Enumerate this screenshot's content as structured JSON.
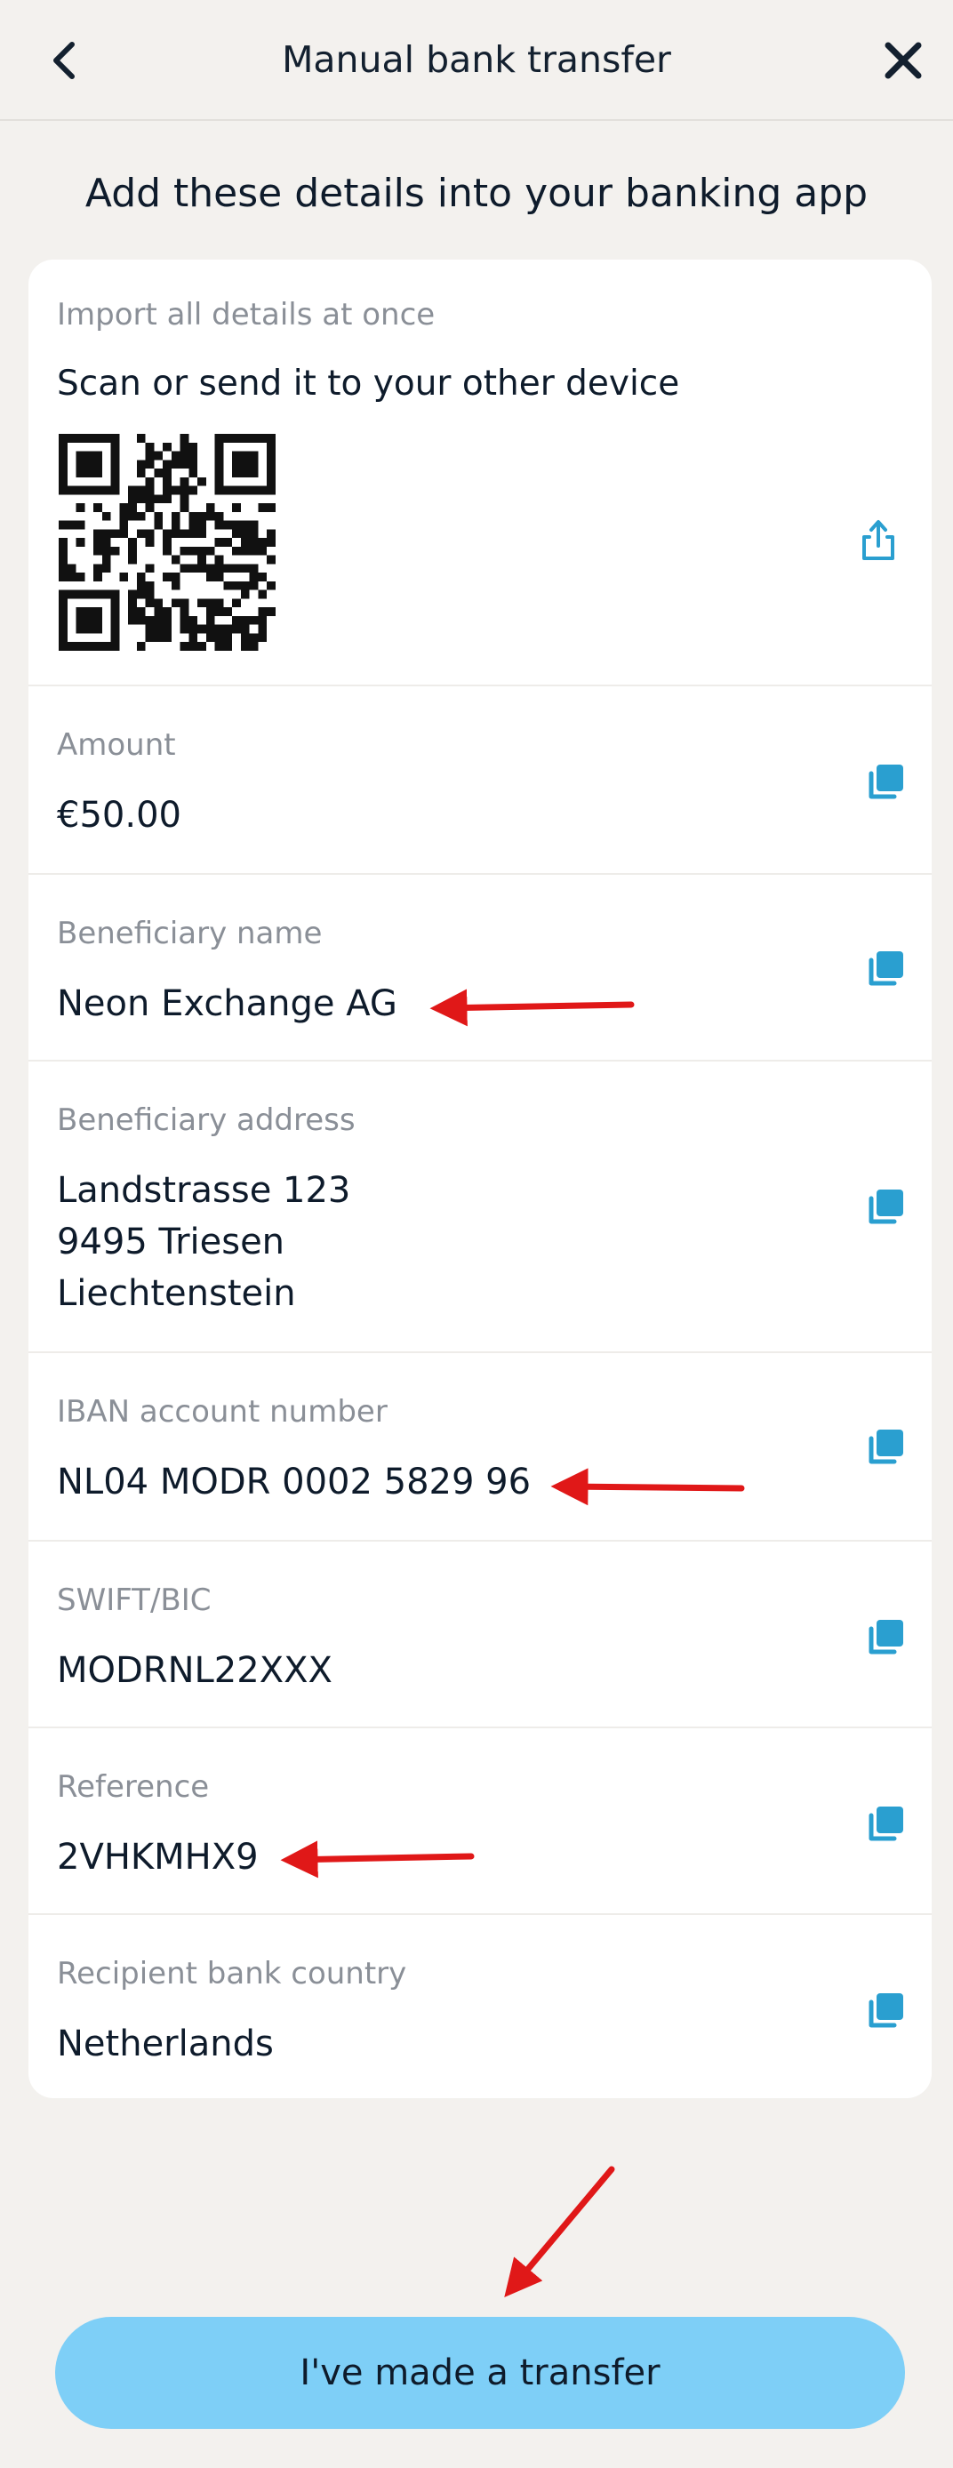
{
  "header": {
    "title": "Manual bank transfer",
    "back_icon": "chevron-left-icon",
    "close_icon": "close-icon"
  },
  "heading": "Add these details into your banking app",
  "qr_section": {
    "caption": "Import all details at once",
    "instruction": "Scan or send it to your other device",
    "share_icon": "share-icon"
  },
  "fields": [
    {
      "label": "Amount",
      "value": "€50.00"
    },
    {
      "label": "Beneficiary name",
      "value": "Neon Exchange AG"
    },
    {
      "label": "Beneficiary address",
      "value": "Landstrasse 123\n9495 Triesen\nLiechtenstein"
    },
    {
      "label": "IBAN account number",
      "value": "NL04 MODR 0002 5829 96"
    },
    {
      "label": "SWIFT/BIC",
      "value": "MODRNL22XXX"
    },
    {
      "label": "Reference",
      "value": "2VHKMHX9"
    },
    {
      "label": "Recipient bank country",
      "value": "Netherlands"
    }
  ],
  "copy_icon": "copy-icon",
  "cta_label": "I've made a transfer",
  "colors": {
    "background": "#f3f1ee",
    "card": "#ffffff",
    "text": "#0e1b2b",
    "label": "#8a8f97",
    "accent_icon": "#2a9fd0",
    "cta": "#7ecff7",
    "annotation_arrow": "#e01818"
  }
}
